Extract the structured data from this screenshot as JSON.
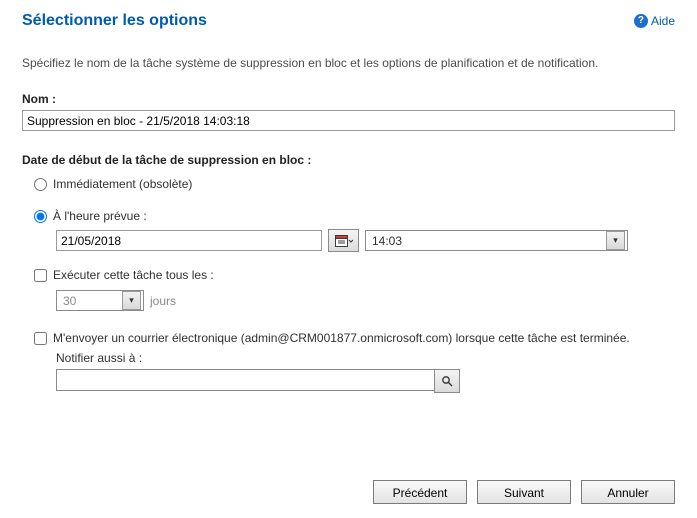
{
  "header": {
    "title": "Sélectionner les options",
    "help_label": "Aide"
  },
  "instructions": "Spécifiez le nom de la tâche système de suppression en bloc et les options de planification et de notification.",
  "sections": {
    "name": {
      "label": "Nom :",
      "value": "Suppression en bloc - 21/5/2018 14:03:18"
    },
    "start": {
      "label": "Date de début de la tâche de suppression en bloc :",
      "immediate_label": "Immédiatement (obsolète)",
      "scheduled_label": "À l'heure prévue :",
      "scheduled_date": "21/05/2018",
      "scheduled_time": "14:03",
      "selected": "scheduled"
    },
    "repeat": {
      "label": "Exécuter cette tâche tous les :",
      "days_value": "30",
      "days_unit": "jours",
      "checked": false
    },
    "notify": {
      "label": "M'envoyer un courrier électronique (admin@CRM001877.onmicrosoft.com) lorsque cette tâche est terminée.",
      "also_label": "Notifier aussi à :",
      "lookup_value": "",
      "checked": false
    }
  },
  "footer": {
    "previous": "Précédent",
    "next": "Suivant",
    "cancel": "Annuler"
  }
}
